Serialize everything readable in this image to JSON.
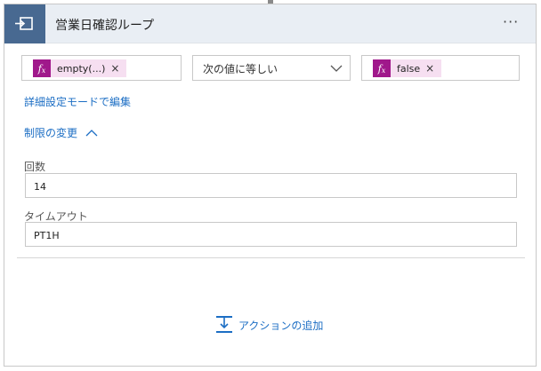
{
  "header": {
    "icon": "loop-icon",
    "title": "営業日確認ループ",
    "menu": "···"
  },
  "condition": {
    "left": {
      "icon": "fx",
      "label": "empty(...)",
      "remove": "×"
    },
    "operator": "次の値に等しい",
    "right": {
      "icon": "fx",
      "label": "false",
      "remove": "×"
    }
  },
  "advanced_link": "詳細設定モードで編集",
  "limits": {
    "label": "制限の変更"
  },
  "count": {
    "label": "回数",
    "value": "14"
  },
  "timeout": {
    "label": "タイムアウト",
    "value": "PT1H"
  },
  "add_action": {
    "label": "アクションの追加",
    "icon": "add-action-icon"
  },
  "colors": {
    "header_icon_bg": "#486991",
    "fx_bg": "#a0188b",
    "token_bg": "#f6dff1",
    "link": "#1c6ec4"
  }
}
